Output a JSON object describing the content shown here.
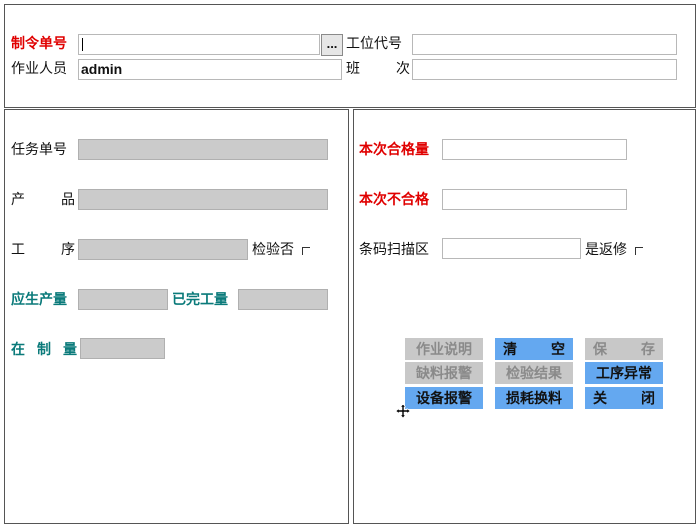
{
  "header": {
    "order_no_label": "制令单号",
    "order_no_value": "",
    "browse_button_label": "...",
    "station_code_label": "工位代号",
    "station_code_value": "",
    "operator_label": "作业人员",
    "operator_value": "admin",
    "shift_label_chars": [
      "班",
      "次"
    ],
    "shift_value": ""
  },
  "left_form": {
    "task_no_label": "任务单号",
    "product_label_chars": [
      "产",
      "品"
    ],
    "process_label_chars": [
      "工",
      "序"
    ],
    "inspect_label": "检验否",
    "planned_qty_label": "应生产量",
    "completed_qty_label": "已完工量",
    "wip_qty_label_chars": [
      "在",
      "制",
      "量"
    ]
  },
  "right_form": {
    "pass_qty_label": "本次合格量",
    "fail_qty_label": "本次不合格",
    "barcode_label": "条码扫描区",
    "rework_label": "是返修"
  },
  "buttons": {
    "row1": [
      {
        "chars": [
          "作业说明"
        ],
        "state": "disabled"
      },
      {
        "chars": [
          "清",
          "空"
        ],
        "state": "active"
      },
      {
        "chars": [
          "保",
          "存"
        ],
        "state": "disabled"
      }
    ],
    "row2": [
      {
        "chars": [
          "缺料报警"
        ],
        "state": "disabled"
      },
      {
        "chars": [
          "检验结果"
        ],
        "state": "disabled"
      },
      {
        "chars": [
          "工序异常"
        ],
        "state": "active"
      }
    ],
    "row3": [
      {
        "chars": [
          "设备报警"
        ],
        "state": "active"
      },
      {
        "chars": [
          "损耗换料"
        ],
        "state": "active"
      },
      {
        "chars": [
          "关",
          "闭"
        ],
        "state": "active"
      }
    ]
  },
  "colors": {
    "required_label": "#e00000",
    "quantity_label": "#0a7a7a",
    "button_active": "#64a8f0",
    "button_disabled": "#c8c8c8",
    "readonly_field": "#cbcbcb"
  },
  "icons": {
    "cursor": "move-cursor-icon"
  }
}
